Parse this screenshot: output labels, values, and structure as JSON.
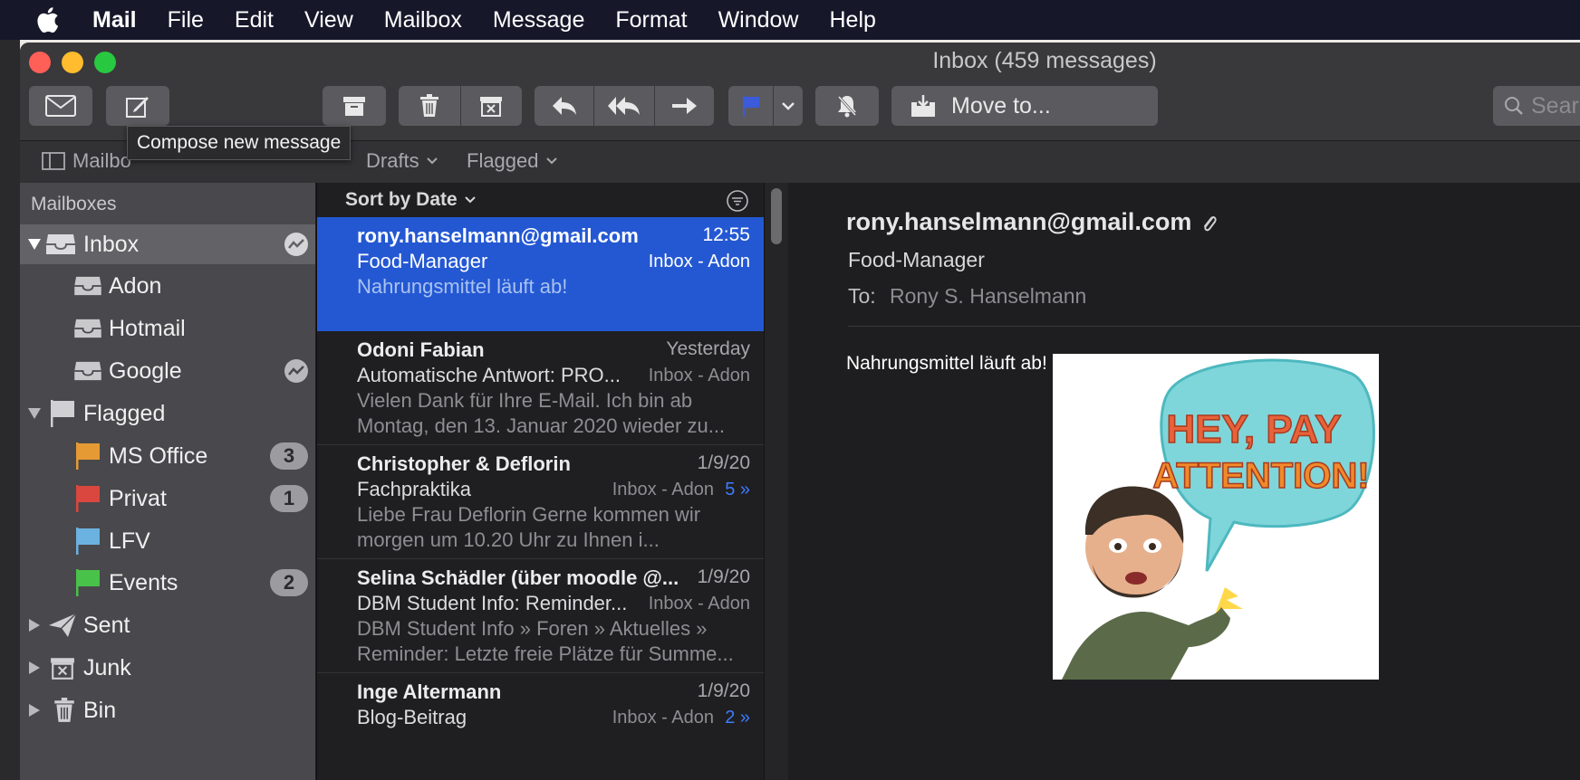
{
  "menubar": {
    "app_name": "Mail",
    "items": [
      "File",
      "Edit",
      "View",
      "Mailbox",
      "Message",
      "Format",
      "Window",
      "Help"
    ]
  },
  "window": {
    "title": "Inbox (459 messages)"
  },
  "toolbar": {
    "move_label": "Move to...",
    "search_placeholder": "Sear"
  },
  "favorites": {
    "mailboxes_label": "Mailbo",
    "drafts_label": "Drafts",
    "flagged_label": "Flagged"
  },
  "tooltip": "Compose new message",
  "sidebar": {
    "header": "Mailboxes",
    "inbox": "Inbox",
    "adon": "Adon",
    "hotmail": "Hotmail",
    "google": "Google",
    "flagged": "Flagged",
    "ms_office": "MS Office",
    "ms_office_count": "3",
    "privat": "Privat",
    "privat_count": "1",
    "lfv": "LFV",
    "events": "Events",
    "events_count": "2",
    "sent": "Sent",
    "junk": "Junk",
    "bin": "Bin",
    "colors": {
      "ms_office": "#e59a34",
      "privat": "#d9473f",
      "lfv": "#6cb2e0",
      "events": "#49c24a"
    }
  },
  "list": {
    "sort_label": "Sort by Date",
    "messages": [
      {
        "sender": "rony.hanselmann@gmail.com",
        "date": "12:55",
        "subject": "Food-Manager",
        "mailbox": "Inbox - Adon",
        "preview": "Nahrungsmittel läuft ab!"
      },
      {
        "sender": "Odoni Fabian",
        "date": "Yesterday",
        "subject": "Automatische Antwort: PRO...",
        "mailbox": "Inbox - Adon",
        "preview": "Vielen Dank für Ihre E-Mail. Ich bin ab Montag, den 13. Januar 2020 wieder zu..."
      },
      {
        "sender": "Christopher & Deflorin",
        "date": "1/9/20",
        "subject": "Fachpraktika",
        "mailbox": "Inbox - Adon",
        "thread": "5 »",
        "preview": "Liebe Frau Deflorin Gerne kommen wir morgen um 10.20 Uhr zu Ihnen i..."
      },
      {
        "sender": "Selina Schädler (über moodle @...",
        "date": "1/9/20",
        "subject": "DBM Student Info: Reminder...",
        "mailbox": "Inbox - Adon",
        "preview": "DBM Student Info » Foren » Aktuelles » Reminder: Letzte freie Plätze für Summe..."
      },
      {
        "sender": "Inge Altermann",
        "date": "1/9/20",
        "subject": "Blog-Beitrag",
        "mailbox": "Inbox - Adon",
        "thread": "2 »",
        "preview": ""
      }
    ]
  },
  "reader": {
    "from": "rony.hanselmann@gmail.com",
    "subject": "Food-Manager",
    "to_label": "To:",
    "to": "Rony S. Hanselmann",
    "body": "Nahrungsmittel läuft ab!",
    "image_text_line1": "HEY, PAY",
    "image_text_line2": "ATTENTION!"
  },
  "colors": {
    "accent": "#2458d3",
    "flag_blue": "#3b5bdb"
  }
}
